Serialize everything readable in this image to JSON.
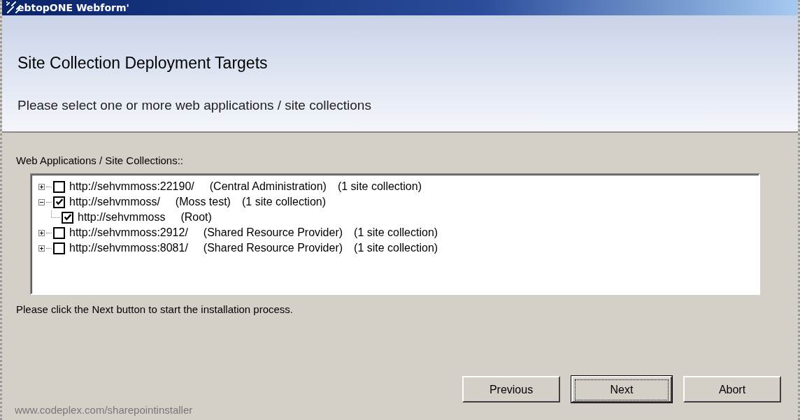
{
  "window": {
    "title": "ebtopONE Webform'"
  },
  "header": {
    "title": "Site Collection Deployment Targets",
    "subtitle": "Please select one or more web applications / site collections"
  },
  "tree": {
    "label": "Web Applications / Site Collections::",
    "items": [
      {
        "url": "http://sehvmmoss:22190/",
        "name": "(Central Administration)",
        "count": "(1 site collection)",
        "checked": false,
        "expanded": false
      },
      {
        "url": "http://sehvmmoss/",
        "name": "(Moss test)",
        "count": "(1 site collection)",
        "checked": true,
        "expanded": true,
        "children": [
          {
            "url": "http://sehvmmoss",
            "name": "(Root)",
            "checked": true
          }
        ]
      },
      {
        "url": "http://sehvmmoss:2912/",
        "name": "(Shared Resource Provider)",
        "count": "(1 site collection)",
        "checked": false,
        "expanded": false
      },
      {
        "url": "http://sehvmmoss:8081/",
        "name": "(Shared Resource Provider)",
        "count": "(1 site collection)",
        "checked": false,
        "expanded": false
      }
    ]
  },
  "instruction": "Please click the Next button to start the installation process.",
  "buttons": [
    {
      "label": "Previous",
      "focused": false
    },
    {
      "label": "Next",
      "focused": true
    },
    {
      "label": "Abort",
      "focused": false
    }
  ],
  "footer": "www.codeplex.com/sharepointinstaller"
}
